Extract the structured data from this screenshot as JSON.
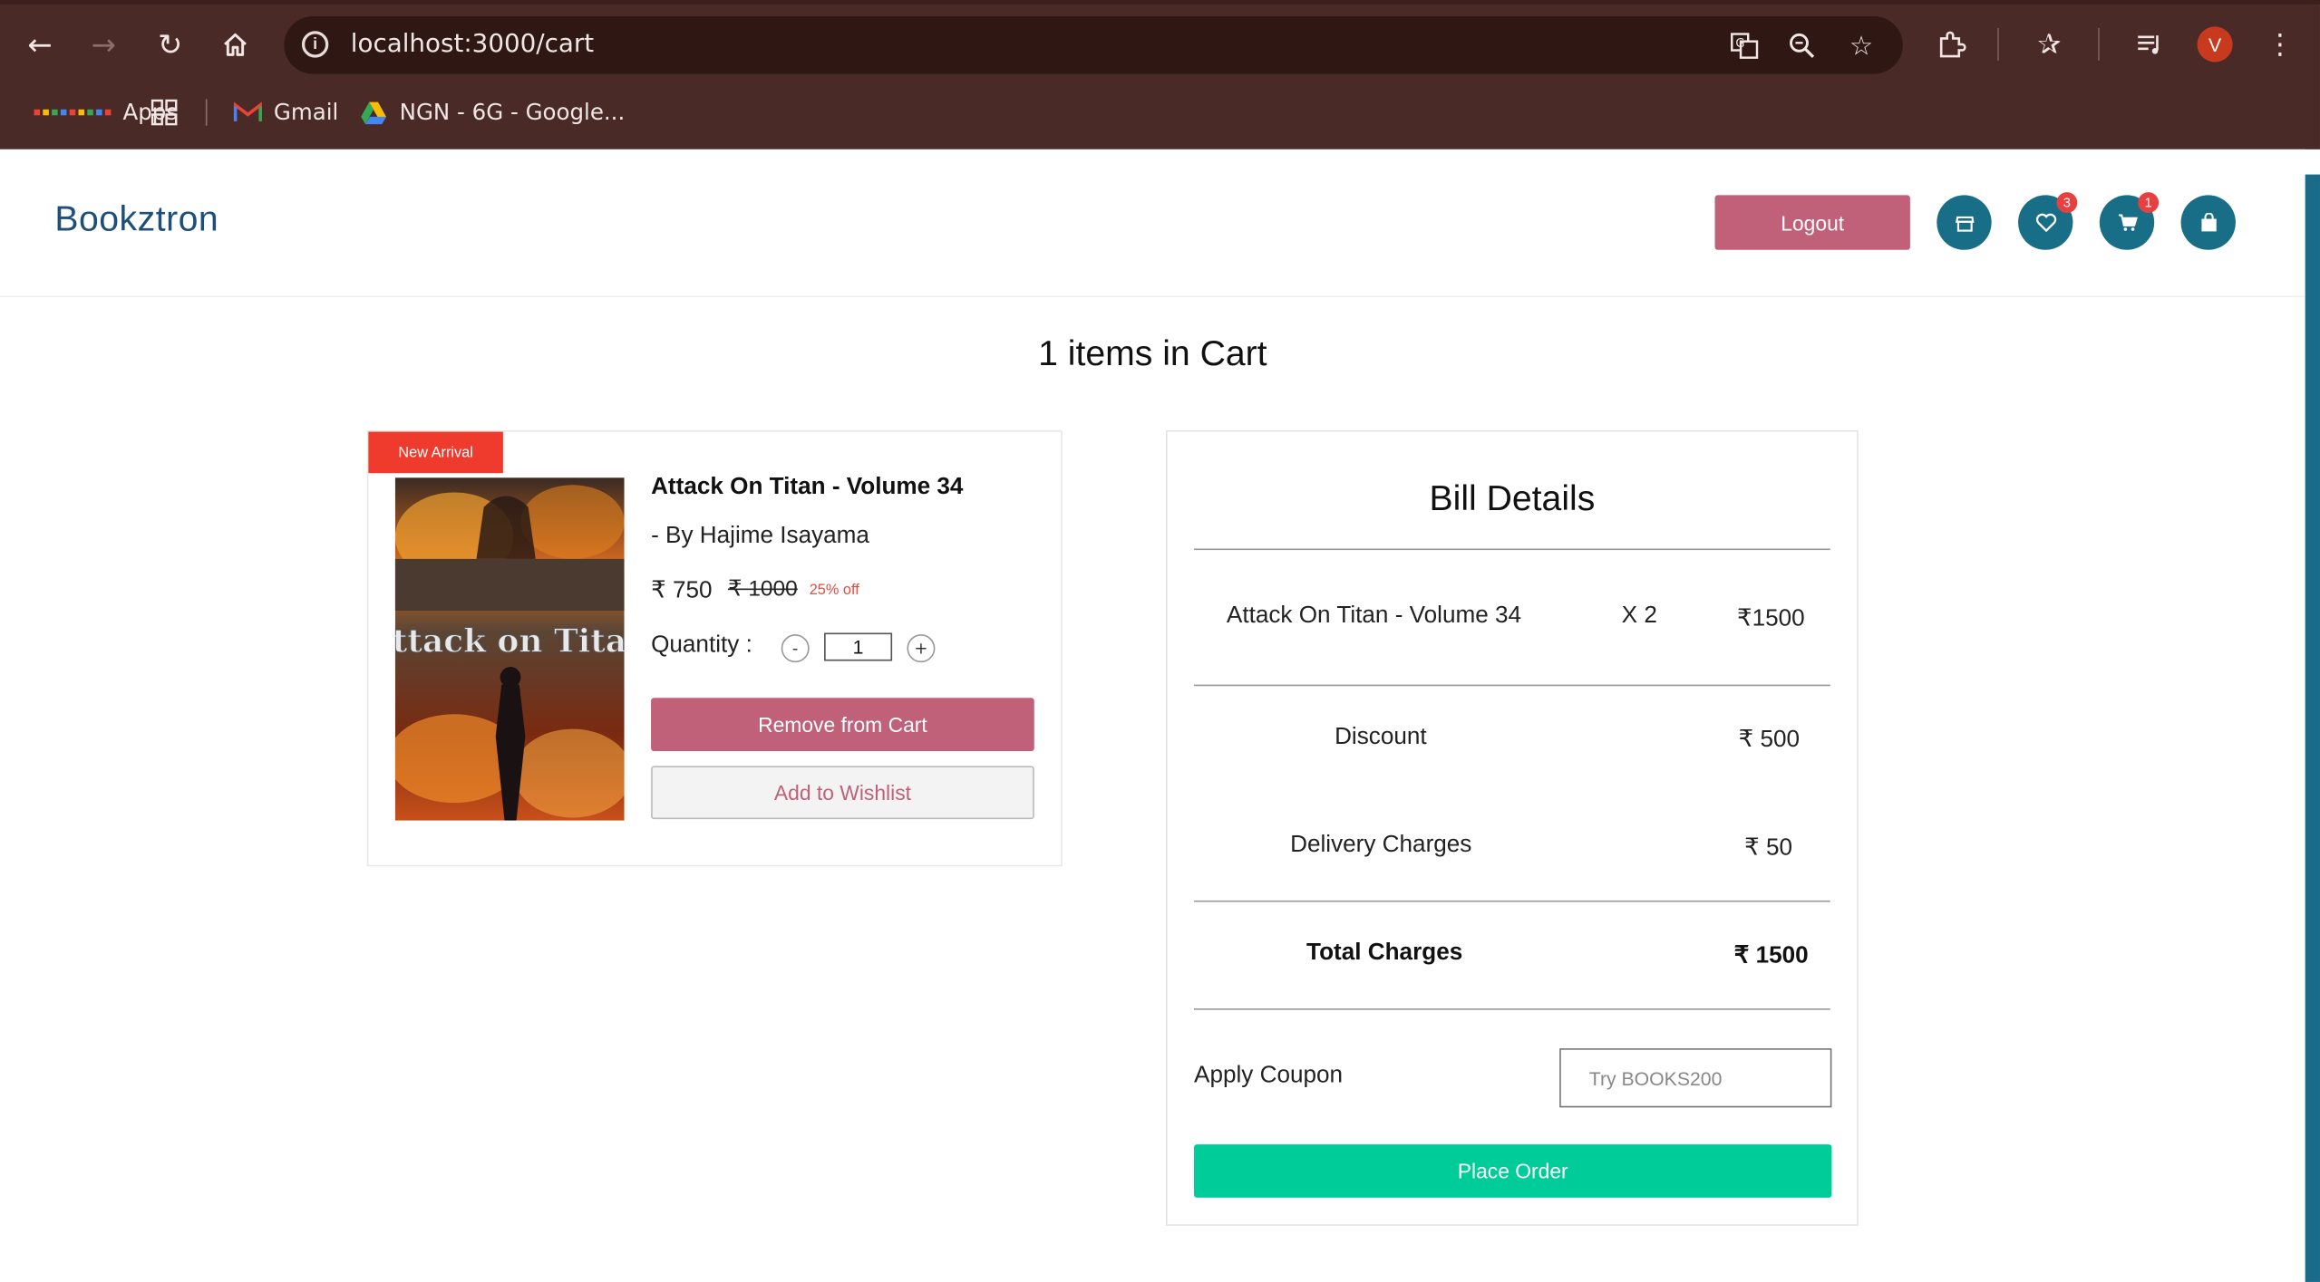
{
  "browser": {
    "url": "localhost:3000/cart",
    "profile_initial": "V",
    "bookmarks": [
      {
        "label": "Apps"
      },
      {
        "label": "Gmail"
      },
      {
        "label": "NGN - 6G - Google..."
      }
    ]
  },
  "header": {
    "brand": "Bookztron",
    "logout_label": "Logout",
    "wishlist_count": "3",
    "cart_count": "1"
  },
  "cart": {
    "title": "1 items in Cart",
    "item": {
      "badge": "New Arrival",
      "cover_title": "Attack on Titan",
      "title": "Attack On Titan - Volume 34",
      "author": "- By  Hajime Isayama",
      "price": "₹ 750",
      "original_price": "₹ 1000",
      "discount": "25% off",
      "quantity_label": "Quantity :",
      "quantity_value": "1",
      "decrement_label": "-",
      "increment_label": "+",
      "remove_label": "Remove from Cart",
      "wishlist_label": "Add to Wishlist"
    }
  },
  "bill": {
    "title": "Bill Details",
    "line_item": {
      "name": "Attack On Titan - Volume 34",
      "qty": "X 2",
      "amount": "₹1500"
    },
    "discount_label": "Discount",
    "discount_value": "₹ 500",
    "delivery_label": "Delivery Charges",
    "delivery_value": "₹ 50",
    "total_label": "Total Charges",
    "total_value": "₹ 1500",
    "coupon_label": "Apply Coupon",
    "coupon_placeholder": "Try BOOKS200",
    "place_order_label": "Place Order"
  },
  "colors": {
    "chrome_bg": "#4a2a27",
    "brand": "#1e4f7a",
    "accent_pink": "#c06079",
    "icon_teal": "#186e86",
    "place_order_green": "#00cc99",
    "ribbon_red": "#ef3b2d"
  }
}
